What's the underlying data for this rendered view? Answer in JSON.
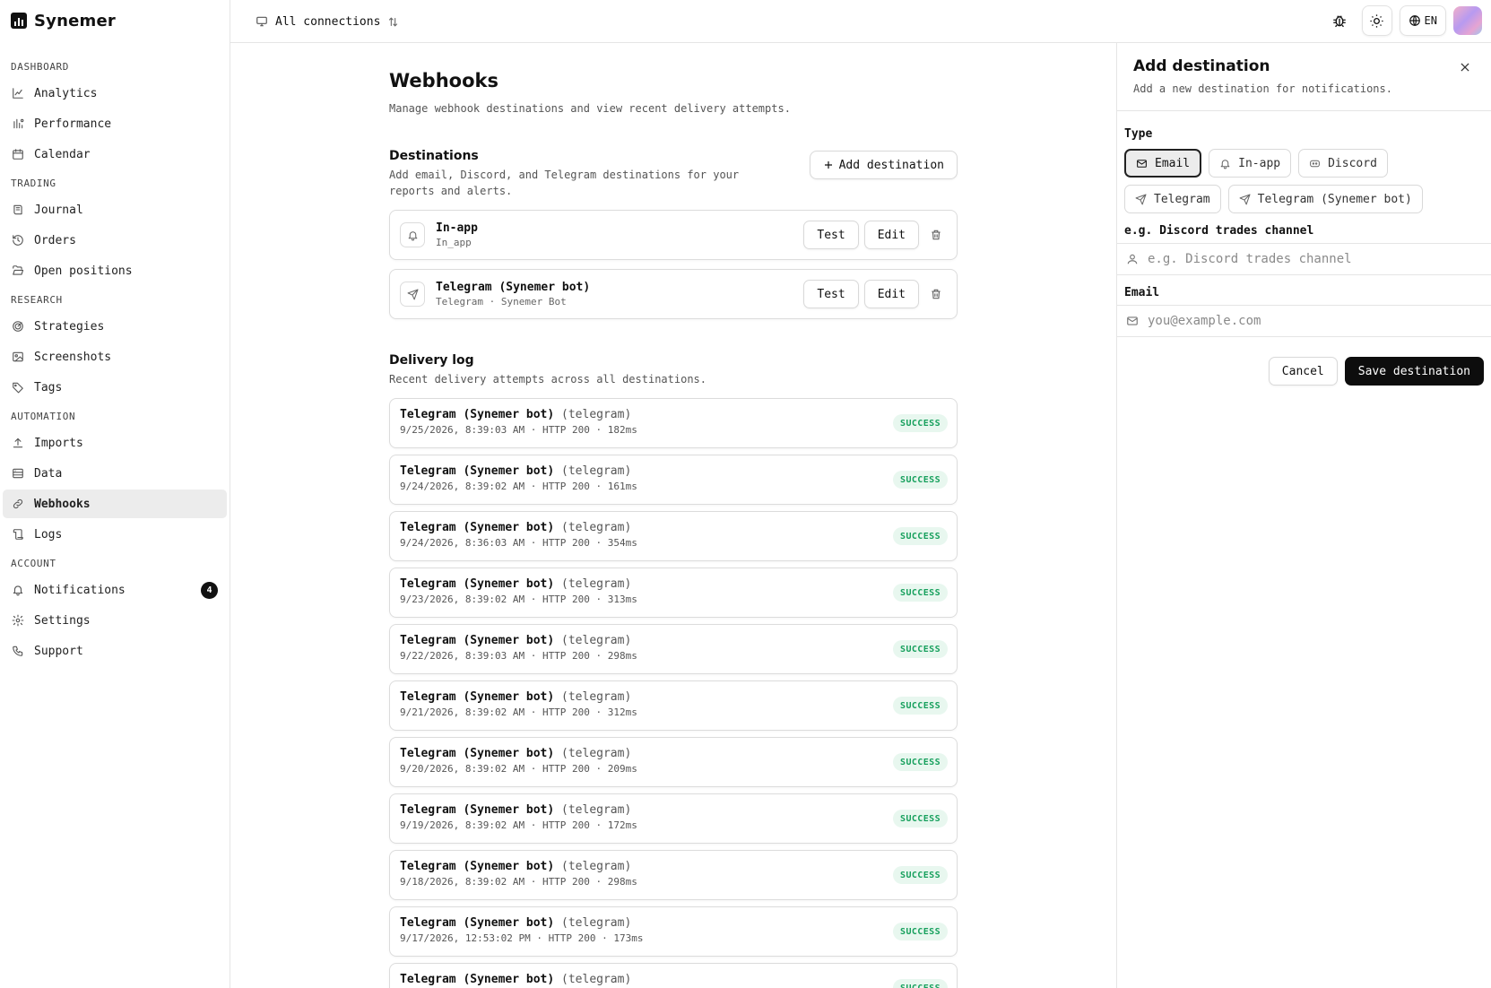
{
  "brand": {
    "name": "Synemer"
  },
  "sidebar": {
    "sections": [
      {
        "title": "DASHBOARD",
        "items": [
          {
            "label": "Analytics",
            "icon": "chart-line-icon"
          },
          {
            "label": "Performance",
            "icon": "bars-icon"
          },
          {
            "label": "Calendar",
            "icon": "calendar-icon"
          }
        ]
      },
      {
        "title": "TRADING",
        "items": [
          {
            "label": "Journal",
            "icon": "book-icon"
          },
          {
            "label": "Orders",
            "icon": "history-icon"
          },
          {
            "label": "Open positions",
            "icon": "folder-open-icon"
          }
        ]
      },
      {
        "title": "RESEARCH",
        "items": [
          {
            "label": "Strategies",
            "icon": "target-icon"
          },
          {
            "label": "Screenshots",
            "icon": "image-icon"
          },
          {
            "label": "Tags",
            "icon": "tag-icon"
          }
        ]
      },
      {
        "title": "AUTOMATION",
        "items": [
          {
            "label": "Imports",
            "icon": "upload-icon"
          },
          {
            "label": "Data",
            "icon": "database-icon"
          },
          {
            "label": "Webhooks",
            "icon": "link-icon",
            "active": true
          },
          {
            "label": "Logs",
            "icon": "scroll-icon"
          }
        ]
      },
      {
        "title": "ACCOUNT",
        "items": [
          {
            "label": "Notifications",
            "icon": "bell-icon",
            "badge": "4"
          },
          {
            "label": "Settings",
            "icon": "gear-icon"
          },
          {
            "label": "Support",
            "icon": "phone-icon"
          }
        ]
      }
    ]
  },
  "topbar": {
    "connections_label": "All connections",
    "language": "EN"
  },
  "page": {
    "title": "Webhooks",
    "description": "Manage webhook destinations and view recent delivery attempts."
  },
  "destinations": {
    "title": "Destinations",
    "description": "Add email, Discord, and Telegram destinations for your reports and alerts.",
    "add_label": "Add destination",
    "items": [
      {
        "name": "In-app",
        "sub": "In_app",
        "icon": "bell-icon"
      },
      {
        "name": "Telegram (Synemer bot)",
        "sub": "Telegram · Synemer Bot",
        "icon": "send-icon"
      }
    ],
    "test_label": "Test",
    "edit_label": "Edit"
  },
  "delivery_log": {
    "title": "Delivery log",
    "description": "Recent delivery attempts across all destinations.",
    "entries": [
      {
        "name": "Telegram (Synemer bot)",
        "kind": "(telegram)",
        "meta": "9/25/2026, 8:39:03 AM · HTTP 200 · 182ms",
        "status": "SUCCESS"
      },
      {
        "name": "Telegram (Synemer bot)",
        "kind": "(telegram)",
        "meta": "9/24/2026, 8:39:02 AM · HTTP 200 · 161ms",
        "status": "SUCCESS"
      },
      {
        "name": "Telegram (Synemer bot)",
        "kind": "(telegram)",
        "meta": "9/24/2026, 8:36:03 AM · HTTP 200 · 354ms",
        "status": "SUCCESS"
      },
      {
        "name": "Telegram (Synemer bot)",
        "kind": "(telegram)",
        "meta": "9/23/2026, 8:39:02 AM · HTTP 200 · 313ms",
        "status": "SUCCESS"
      },
      {
        "name": "Telegram (Synemer bot)",
        "kind": "(telegram)",
        "meta": "9/22/2026, 8:39:03 AM · HTTP 200 · 298ms",
        "status": "SUCCESS"
      },
      {
        "name": "Telegram (Synemer bot)",
        "kind": "(telegram)",
        "meta": "9/21/2026, 8:39:02 AM · HTTP 200 · 312ms",
        "status": "SUCCESS"
      },
      {
        "name": "Telegram (Synemer bot)",
        "kind": "(telegram)",
        "meta": "9/20/2026, 8:39:02 AM · HTTP 200 · 209ms",
        "status": "SUCCESS"
      },
      {
        "name": "Telegram (Synemer bot)",
        "kind": "(telegram)",
        "meta": "9/19/2026, 8:39:02 AM · HTTP 200 · 172ms",
        "status": "SUCCESS"
      },
      {
        "name": "Telegram (Synemer bot)",
        "kind": "(telegram)",
        "meta": "9/18/2026, 8:39:02 AM · HTTP 200 · 298ms",
        "status": "SUCCESS"
      },
      {
        "name": "Telegram (Synemer bot)",
        "kind": "(telegram)",
        "meta": "9/17/2026, 12:53:02 PM · HTTP 200 · 173ms",
        "status": "SUCCESS"
      },
      {
        "name": "Telegram (Synemer bot)",
        "kind": "(telegram)",
        "meta": "",
        "status": "SUCCESS"
      }
    ]
  },
  "panel": {
    "title": "Add destination",
    "description": "Add a new destination for notifications.",
    "type_label": "Type",
    "types": [
      {
        "label": "Email",
        "icon": "mail-icon",
        "active": true
      },
      {
        "label": "In-app",
        "icon": "bell-icon"
      },
      {
        "label": "Discord",
        "icon": "discord-icon"
      },
      {
        "label": "Telegram",
        "icon": "send-icon"
      },
      {
        "label": "Telegram (Synemer bot)",
        "icon": "send-icon"
      }
    ],
    "name_label": "e.g. Discord trades channel",
    "name_placeholder": "e.g. Discord trades channel",
    "email_label": "Email",
    "email_placeholder": "you@example.com",
    "cancel_label": "Cancel",
    "save_label": "Save destination"
  },
  "colors": {
    "accent": "#0d0d0d",
    "success_text": "#17a05d",
    "success_bg": "#e8f7ef",
    "active_nav": "#ececec"
  }
}
